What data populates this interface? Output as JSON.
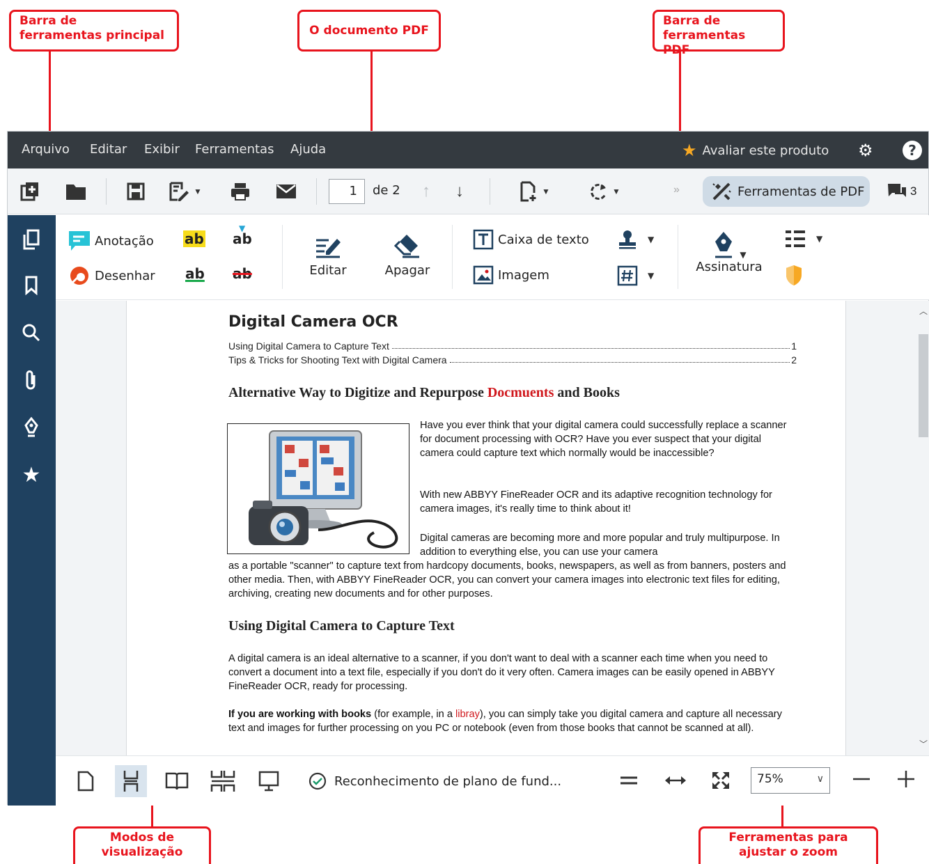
{
  "callouts": {
    "main_toolbar": "Barra de\nferramentas principal",
    "pdf_document": "O documento PDF",
    "pdf_toolbar": "Barra de\nferramentas PDF",
    "view_modes": "Modos de\nvisualização",
    "zoom_tools": "Ferramentas para\najustar o zoom"
  },
  "menu": {
    "items": [
      "Arquivo",
      "Editar",
      "Exibir",
      "Ferramentas",
      "Ajuda"
    ],
    "rate_label": "Avaliar este produto"
  },
  "main_toolbar": {
    "page_current": "1",
    "page_of": "de 2",
    "pdf_tools_label": "Ferramentas de PDF",
    "comments_count": "3",
    "overflow": "»"
  },
  "pdf_toolbar": {
    "annotation": "Anotação",
    "draw": "Desenhar",
    "ab": "ab",
    "edit": "Editar",
    "erase": "Apagar",
    "text_box": "Caixa de texto",
    "image": "Imagem",
    "signature": "Assinatura"
  },
  "document": {
    "title": "Digital Camera OCR",
    "toc": [
      {
        "text": "Using Digital Camera to Capture Text",
        "page": "1"
      },
      {
        "text": "Tips & Tricks for Shooting Text with Digital Camera",
        "page": "2"
      }
    ],
    "heading1_before": "Alternative Way to Digitize and Repurpose ",
    "heading1_red": "Docmuents",
    "heading1_after": " and Books",
    "p1": "Have you ever think that your digital camera could successfully replace a scanner for document processing with OCR? Have you ever suspect that your digital camera could capture text which normally would be inaccessible?",
    "p2": "With new ABBYY FineReader OCR and its adaptive recognition technology  for camera images, it's really time to think about it!",
    "p3a": "Digital cameras are becoming more and more popular and truly multipurpose. In addition to everything else, you can use your camera",
    "p3b": "as a portable \"scanner\" to capture text from hardcopy documents, books, newspapers, as well as from banners, posters and other media. Then, with ABBYY FineReader OCR, you can convert your camera images into electronic text files for editing, archiving, creating new documents and for other purposes.",
    "heading2": "Using Digital Camera to Capture Text",
    "p4": "A digital camera is an ideal alternative to a scanner, if you don't want to deal with a scanner each time when you need to convert a document into a text file, especially if you don't do it very often. Camera images can be easily opened in ABBYY FineReader OCR, ready for processing.",
    "p5_bold": "If you are working with books",
    "p5_a": " (for example, in a ",
    "p5_red": "libray",
    "p5_b": "), you can simply take you digital camera and capture all necessary text and images for further processing on you PC or notebook (even from those books that cannot be scanned at all)."
  },
  "statusbar": {
    "background_recognition": "Reconhecimento de plano de fund...",
    "zoom": "75%"
  },
  "colors": {
    "callout_red": "#e8141d",
    "menubar": "#343a40",
    "sidebar": "#1f4160",
    "accent_blue": "#1f4160"
  }
}
